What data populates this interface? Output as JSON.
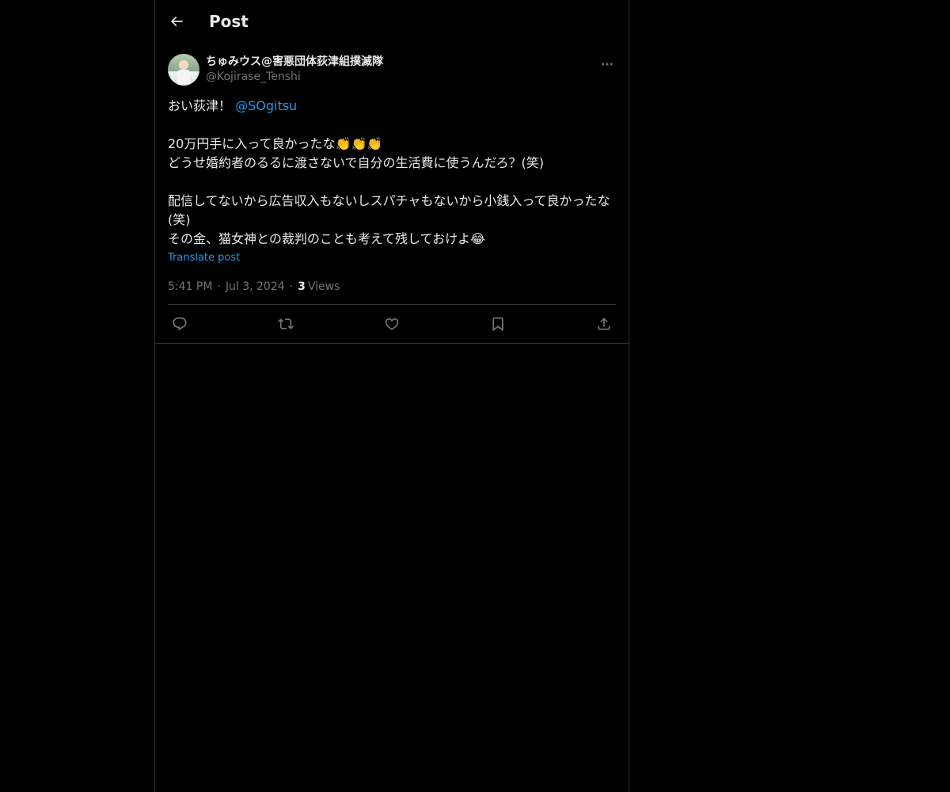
{
  "header": {
    "title": "Post",
    "back_icon": "arrow-left-icon"
  },
  "post": {
    "author": {
      "display_name": "ちゅみウス@害悪団体荻津組撲滅隊",
      "handle": "@Kojirase_Tenshi"
    },
    "text": {
      "line1_prefix": "おい荻津！ ",
      "mention": "@SOgitsu",
      "body": "20万円手に入って良かったな👏👏👏\nどうせ婚約者のるるに渡さないで自分の生活費に使うんだろ？(笑)\n\n配信してないから広告収入もないしスパチャもないから小銭入って良かったな(笑)\nその金、猫女神との裁判のことも考えて残しておけよ😂"
    },
    "translate_label": "Translate post",
    "time": "5:41 PM",
    "date": "Jul 3, 2024",
    "views_count": "3",
    "views_label": "Views",
    "separator": "·"
  },
  "actions": {
    "reply_icon": "reply-icon",
    "repost_icon": "repost-icon",
    "like_icon": "heart-icon",
    "bookmark_icon": "bookmark-icon",
    "share_icon": "share-icon"
  },
  "colors": {
    "background": "#000000",
    "text": "#e7e9ea",
    "secondary": "#71767b",
    "accent": "#1d9bf0",
    "border": "#2f3336"
  }
}
